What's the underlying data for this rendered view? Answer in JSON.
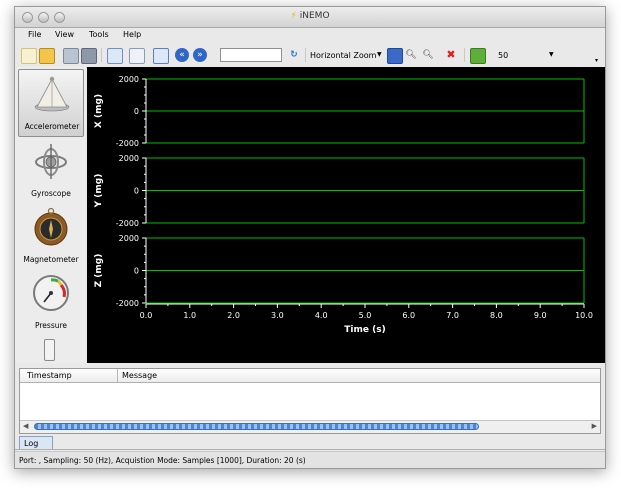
{
  "window": {
    "title": "iNEMO"
  },
  "menu": {
    "items": [
      {
        "label": "File"
      },
      {
        "label": "View"
      },
      {
        "label": "Tools"
      },
      {
        "label": "Help"
      }
    ]
  },
  "toolbar": {
    "zoom_mode": "Horizontal Zoom",
    "samples_value": "50",
    "time_input_value": ""
  },
  "sidebar": {
    "items": [
      {
        "label": "Accelerometer",
        "icon": "accelerometer-icon",
        "active": true
      },
      {
        "label": "Gyroscope",
        "icon": "gyroscope-icon",
        "active": false
      },
      {
        "label": "Magnetometer",
        "icon": "magnetometer-icon",
        "active": false
      },
      {
        "label": "Pressure",
        "icon": "pressure-gauge-icon",
        "active": false
      }
    ]
  },
  "chart_data": {
    "type": "line",
    "xlabel": "Time (s)",
    "xlim": [
      0.0,
      10.0
    ],
    "x_ticks": [
      "0.0",
      "1.0",
      "2.0",
      "3.0",
      "4.0",
      "5.0",
      "6.0",
      "7.0",
      "8.0",
      "9.0",
      "10.0"
    ],
    "grid": true,
    "background": "#000000",
    "grid_color": "#00c000",
    "axis_color": "#ffffff",
    "panels": [
      {
        "ylabel": "X (mg)",
        "ylim": [
          -2000,
          2000
        ],
        "y_ticks": [
          "2000",
          "0",
          "-2000"
        ],
        "series": []
      },
      {
        "ylabel": "Y (mg)",
        "ylim": [
          -2000,
          2000
        ],
        "y_ticks": [
          "2000",
          "0",
          "-2000"
        ],
        "series": []
      },
      {
        "ylabel": "Z (mg)",
        "ylim": [
          -2000,
          2000
        ],
        "y_ticks": [
          "2000",
          "0",
          "-2000"
        ],
        "series": []
      }
    ]
  },
  "log": {
    "columns": [
      "Timestamp",
      "Message"
    ],
    "rows": [],
    "tab_label": "Log"
  },
  "status": {
    "text": "Port: , Sampling: 50 (Hz), Acquistion Mode: Samples [1000], Duration: 20 (s)"
  }
}
